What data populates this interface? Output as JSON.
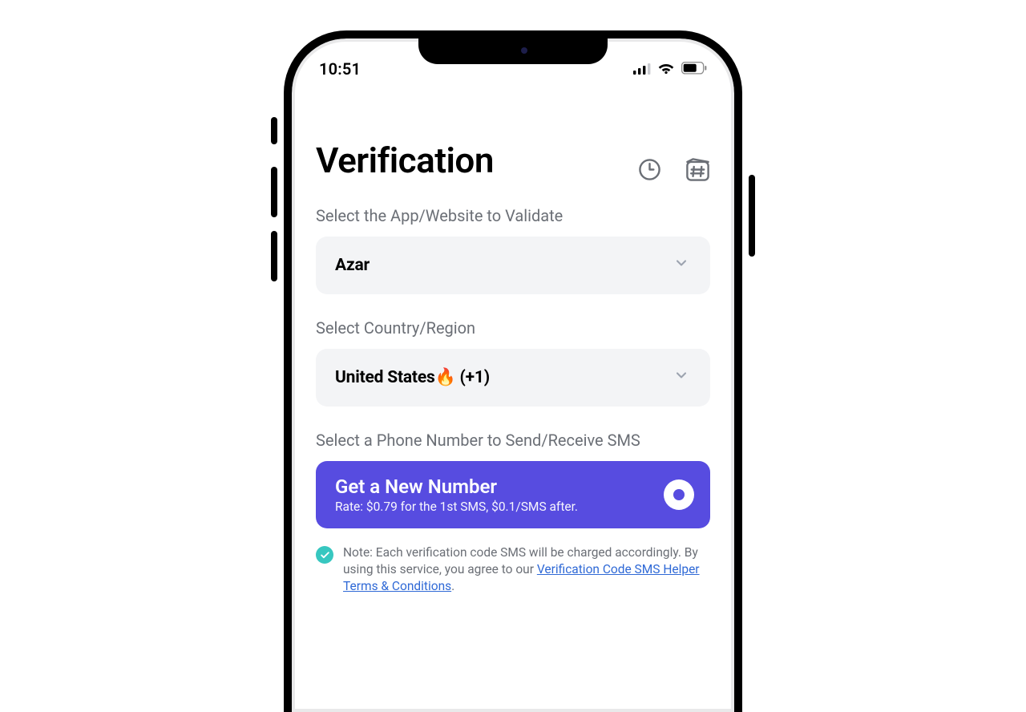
{
  "statusbar": {
    "time": "10:51"
  },
  "header": {
    "title": "Verification"
  },
  "app": {
    "label": "Select the App/Website to Validate",
    "selected": "Azar"
  },
  "country": {
    "label": "Select Country/Region",
    "selected": "United States🔥 (+1)"
  },
  "number": {
    "label": "Select a Phone Number to Send/Receive SMS",
    "cta_title": "Get a New Number",
    "cta_rate": "Rate: $0.79 for the 1st SMS, $0.1/SMS after."
  },
  "note": {
    "pre": "Note: Each verification code SMS will be charged accordingly. By using this service, you agree to our ",
    "link": "Verification Code SMS Helper Terms & Conditions",
    "post": "."
  }
}
